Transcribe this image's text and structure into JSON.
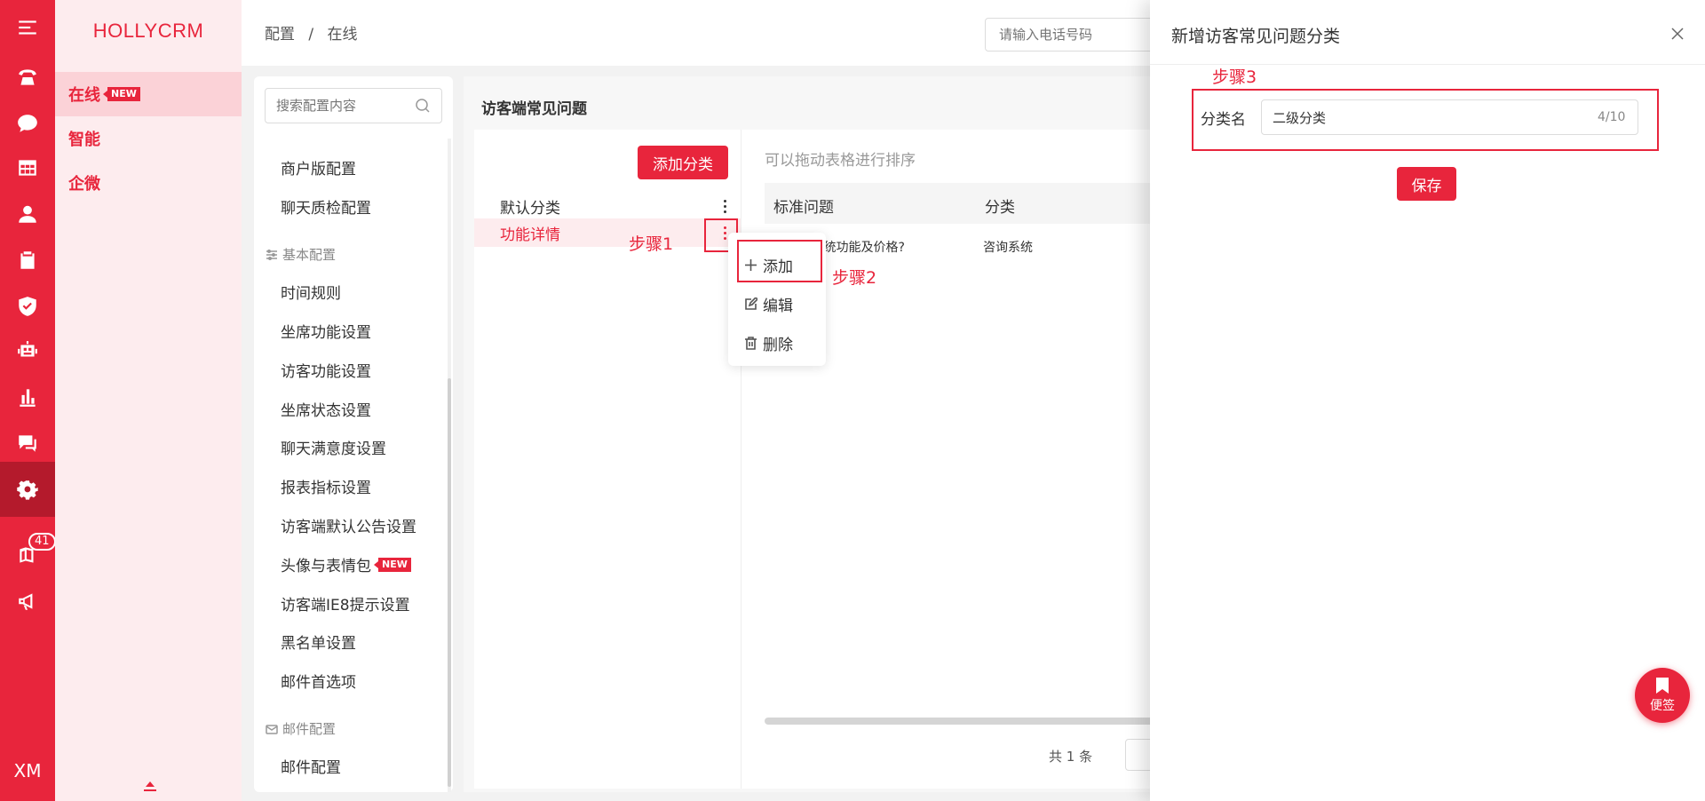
{
  "app": {
    "brand": "HOLLYCRM"
  },
  "rail": {
    "badge_count": "41",
    "user_initials": "XM"
  },
  "subnav": {
    "items": [
      {
        "label": "在线",
        "tag": "NEW"
      },
      {
        "label": "智能"
      },
      {
        "label": "企微"
      }
    ]
  },
  "header": {
    "breadcrumb": [
      "配置",
      "/",
      "在线"
    ],
    "phone_placeholder": "请输入电话号码"
  },
  "config_menu": {
    "search_placeholder": "搜索配置内容",
    "items_top": [
      "商户版配置",
      "聊天质检配置"
    ],
    "group_basic": "基本配置",
    "items_basic": [
      "时间规则",
      "坐席功能设置",
      "访客功能设置",
      "坐席状态设置",
      "聊天满意度设置",
      "报表指标设置",
      "访客端默认公告设置",
      "头像与表情包",
      "访客端IE8提示设置",
      "黑名单设置",
      "邮件首选项"
    ],
    "avatar_tag": "NEW",
    "group_mail": "邮件配置",
    "items_mail": [
      "邮件配置"
    ]
  },
  "main": {
    "title": "访客端常见问题",
    "add_category_label": "添加分类",
    "categories": [
      "默认分类",
      "功能详情"
    ],
    "drag_tip": "可以拖动表格进行排序",
    "columns": [
      "标准问题",
      "分类"
    ],
    "rows": [
      {
        "question": "系统功能及价格?",
        "category": "咨询系统"
      }
    ],
    "total_text": "共 1 条"
  },
  "context_menu": {
    "items": [
      "添加",
      "编辑",
      "删除"
    ]
  },
  "steps": [
    "步骤1",
    "步骤2",
    "步骤3"
  ],
  "drawer": {
    "title": "新增访客常见问题分类",
    "field_label": "分类名",
    "field_value": "二级分类",
    "char_count": "4/10",
    "save_label": "保存"
  },
  "sticky_note": {
    "label": "便签"
  },
  "colors": {
    "accent": "#e8253c",
    "accent_dark": "#b41a2c",
    "subnav_bg": "#fdecee"
  }
}
